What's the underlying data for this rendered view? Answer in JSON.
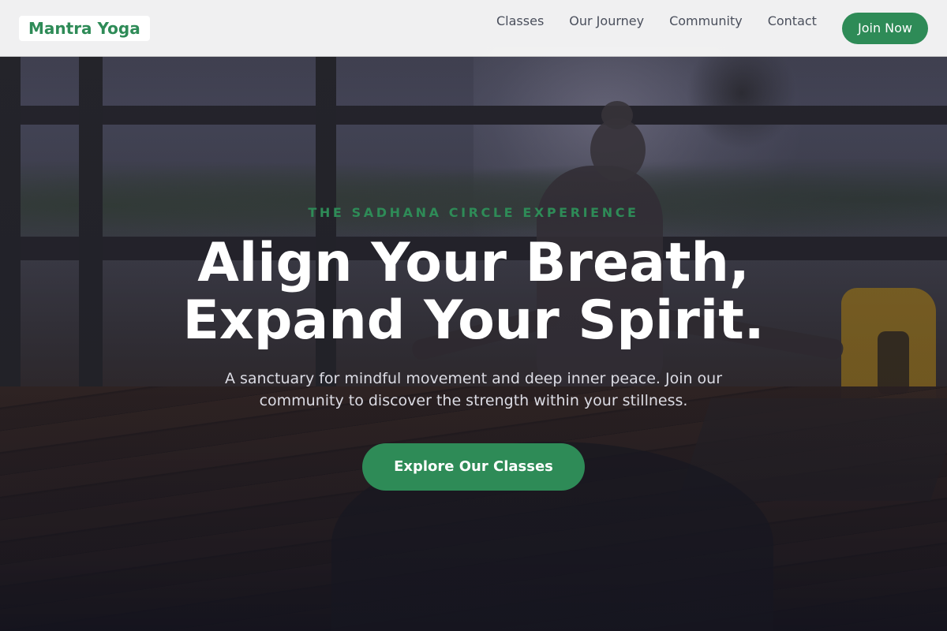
{
  "brand": {
    "name": "Mantra Yoga",
    "accent_color": "#2e8b57"
  },
  "nav": {
    "links": [
      {
        "label": "Classes"
      },
      {
        "label": "Our Journey"
      },
      {
        "label": "Community"
      },
      {
        "label": "Contact"
      }
    ],
    "cta_label": "Join Now"
  },
  "hero": {
    "eyebrow": "THE SADHANA CIRCLE EXPERIENCE",
    "headline_line1": "Align Your Breath,",
    "headline_line2": "Expand Your Spirit.",
    "subtext": "A sanctuary for mindful movement and deep inner peace. Join our community to discover the strength within your stillness.",
    "cta_label": "Explore Our Classes",
    "background_image": "yoga-meditation-deck-photo"
  }
}
